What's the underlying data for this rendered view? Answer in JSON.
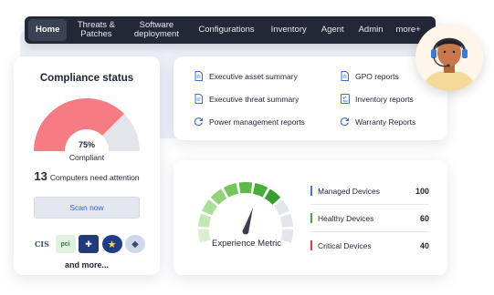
{
  "nav": {
    "items": [
      {
        "label": "Home",
        "active": true
      },
      {
        "label": "Threats & Patches"
      },
      {
        "label": "Software deployment"
      },
      {
        "label": "Configurations"
      },
      {
        "label": "Inventory"
      },
      {
        "label": "Agent"
      },
      {
        "label": "Admin"
      },
      {
        "label": "more+"
      }
    ]
  },
  "compliance": {
    "title": "Compliance status",
    "percent_text": "75%",
    "percent_value": 75,
    "status_label": "Compliant",
    "attention_count": "13",
    "attention_text": "Computers need attention",
    "scan_button": "Scan now",
    "logos": [
      "CIS",
      "pci",
      "HIPAA",
      "star-badge",
      "eagle-seal"
    ],
    "logo_text": {
      "cis": "CIS",
      "pci": "pci",
      "hipaa": "✚"
    },
    "more_text": "and more...",
    "colors": {
      "compliant": "#f77b82",
      "remaining": "#e3e5ea"
    }
  },
  "reports": {
    "left": [
      {
        "label": "Executive asset summary",
        "icon": "document-icon"
      },
      {
        "label": "Executive threat summary",
        "icon": "document-icon"
      },
      {
        "label": "Power management reports",
        "icon": "refresh-icon"
      }
    ],
    "right": [
      {
        "label": "GPO reports",
        "icon": "document-icon"
      },
      {
        "label": "Inventory reports",
        "icon": "checklist-icon"
      },
      {
        "label": "Warranty Reports",
        "icon": "refresh-icon"
      }
    ]
  },
  "experience": {
    "title": "Experience Metric",
    "meter_segments_green": 8,
    "meter_segments_total": 11,
    "devices": [
      {
        "label": "Managed Devices",
        "value": "100",
        "color": "#3b7be0"
      },
      {
        "label": "Healthy Devices",
        "value": "60",
        "color": "#3fa84a"
      },
      {
        "label": "Critical Devices",
        "value": "40",
        "color": "#e23b3b"
      }
    ]
  },
  "colors": {
    "navbar": "#232836",
    "accent": "#2f63d6"
  }
}
